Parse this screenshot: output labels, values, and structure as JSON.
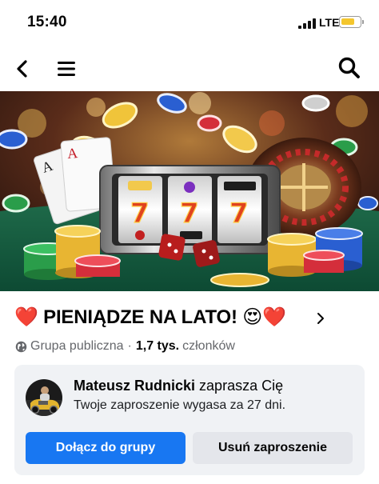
{
  "status_bar": {
    "time": "15:40",
    "network": "LTE",
    "battery_color": "#f4c62d"
  },
  "nav": {
    "back_icon": "chevron-left-icon",
    "menu_icon": "hamburger-menu-icon",
    "search_icon": "search-icon"
  },
  "group": {
    "name": "❤️ PIENIĄDZE NA LATO! 😍❤️",
    "privacy": "Grupa publiczna",
    "separator": "·",
    "member_count": "1,7 tys.",
    "member_label": "członków"
  },
  "invite": {
    "inviter_name": "Mateusz Rudnicki",
    "invite_text": "zaprasza Cię",
    "expiry_text": "Twoje zaproszenie wygasa za 27 dni.",
    "join_label": "Dołącz do grupy",
    "remove_label": "Usuń zaproszenie"
  },
  "colors": {
    "accent": "#1877f2",
    "secondary_button": "#e4e6eb",
    "card_background": "#f0f2f5",
    "muted_text": "#65676b"
  }
}
